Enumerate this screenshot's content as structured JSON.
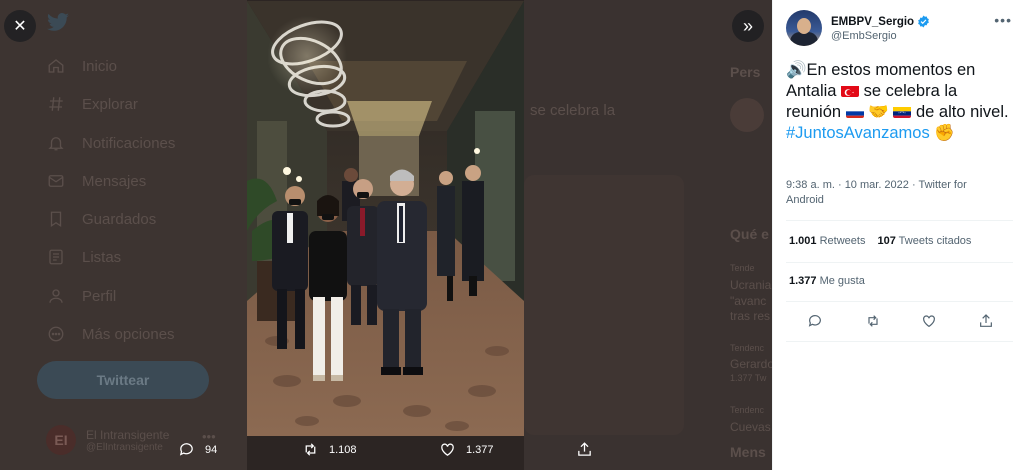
{
  "background_nav": {
    "items": [
      {
        "label": "Inicio",
        "icon": "home-icon"
      },
      {
        "label": "Explorar",
        "icon": "hashtag-icon"
      },
      {
        "label": "Notificaciones",
        "icon": "bell-icon"
      },
      {
        "label": "Mensajes",
        "icon": "mail-icon"
      },
      {
        "label": "Guardados",
        "icon": "bookmark-icon"
      },
      {
        "label": "Listas",
        "icon": "list-icon"
      },
      {
        "label": "Perfil",
        "icon": "person-icon"
      },
      {
        "label": "Más opciones",
        "icon": "more-icon"
      }
    ],
    "tweet_button": "Twittear",
    "account_name": "El Intransigente",
    "account_handle": "@ElIntransigente",
    "account_initials": "EI"
  },
  "background_content": {
    "tweet_snippet": "se celebra la",
    "side_heading": "Pers",
    "trends_heading": "Qué e",
    "trend_snippets": [
      "Tende",
      "Ucrania",
      "\"avanc",
      "tras res",
      "Tendenc",
      "Gerardo",
      "1.377 Tw",
      "Tendenc",
      "Cuevas"
    ],
    "more_heading": "Mens"
  },
  "media_actions": {
    "replies": "94",
    "retweets": "1.108",
    "likes": "1.377"
  },
  "tweet": {
    "author_name": "EMBPV_Sergio",
    "author_handle": "@EmbSergio",
    "text_part1": "🔊En estos momentos en Antalia",
    "text_part2": "se celebra la reunión",
    "text_part3": "de alto nivel.",
    "hashtag": "#JuntosAvanzamos",
    "handshake_emoji": "🤝",
    "fist_emoji": "✊",
    "timestamp": "9:38 a. m. · 10 mar. 2022 · Twitter for Android",
    "retweets_count": "1.001",
    "retweets_label": "Retweets",
    "quotes_count": "107",
    "quotes_label": "Tweets citados",
    "likes_count": "1.377",
    "likes_label": "Me gusta"
  },
  "colors": {
    "accent": "#1d9bf0",
    "verified": "#1d9bf0",
    "overlay": "#2c2523"
  }
}
